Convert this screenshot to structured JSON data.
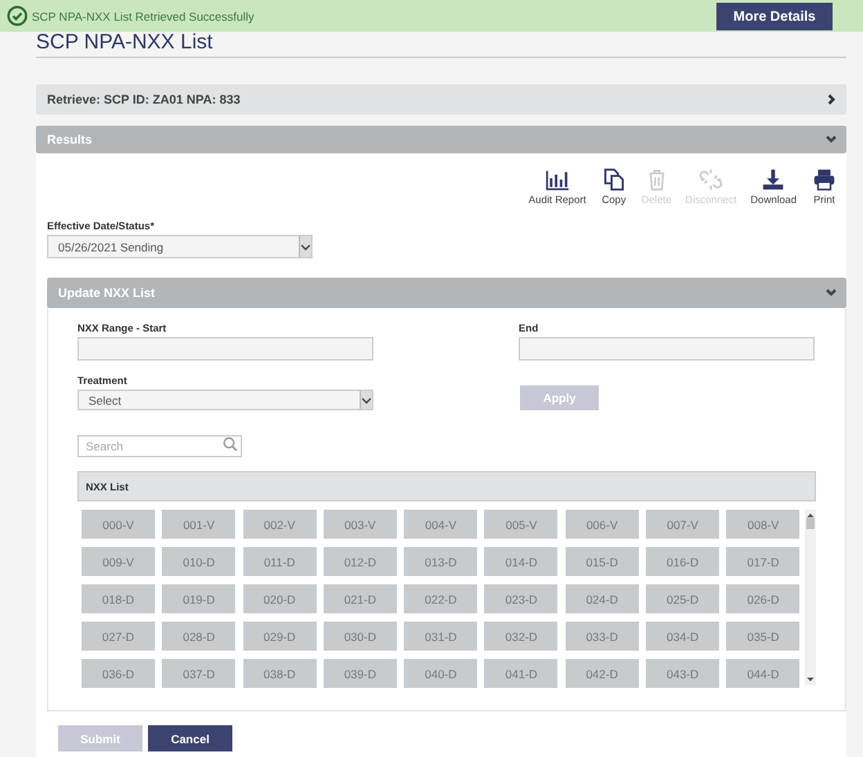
{
  "banner": {
    "message": "SCP NPA-NXX List Retrieved Successfully",
    "button": "More Details"
  },
  "page_title": "SCP NPA-NXX List",
  "retrieve_bar": {
    "label": "Retrieve: SCP ID: ZA01 NPA: 833",
    "expanded": false
  },
  "results": {
    "title": "Results",
    "expanded": true
  },
  "toolbar": [
    {
      "kind": "audit",
      "label": "Audit Report",
      "disabled": false
    },
    {
      "kind": "copy",
      "label": "Copy",
      "disabled": false
    },
    {
      "kind": "delete",
      "label": "Delete",
      "disabled": true
    },
    {
      "kind": "disconnect",
      "label": "Disconnect",
      "disabled": true
    },
    {
      "kind": "download",
      "label": "Download",
      "disabled": false
    },
    {
      "kind": "print",
      "label": "Print",
      "disabled": false
    }
  ],
  "effective": {
    "label": "Effective Date/Status*",
    "value": "05/26/2021 Sending"
  },
  "update_panel": {
    "title": "Update NXX List",
    "expanded": true,
    "range_start_label": "NXX Range - Start",
    "end_label": "End",
    "treatment_label": "Treatment",
    "treatment_value": "Select",
    "apply": "Apply",
    "apply_disabled": true,
    "search_placeholder": "Search",
    "list_title": "NXX List",
    "nxx": [
      "000-V",
      "001-V",
      "002-V",
      "003-V",
      "004-V",
      "005-V",
      "006-V",
      "007-V",
      "008-V",
      "009-V",
      "010-D",
      "011-D",
      "012-D",
      "013-D",
      "014-D",
      "015-D",
      "016-D",
      "017-D",
      "018-D",
      "019-D",
      "020-D",
      "021-D",
      "022-D",
      "023-D",
      "024-D",
      "025-D",
      "026-D",
      "027-D",
      "028-D",
      "029-D",
      "030-D",
      "031-D",
      "032-D",
      "033-D",
      "034-D",
      "035-D",
      "036-D",
      "037-D",
      "038-D",
      "039-D",
      "040-D",
      "041-D",
      "042-D",
      "043-D",
      "044-D"
    ]
  },
  "buttons": [
    {
      "label": "Submit",
      "disabled": true
    },
    {
      "label": "Cancel",
      "disabled": false
    }
  ]
}
